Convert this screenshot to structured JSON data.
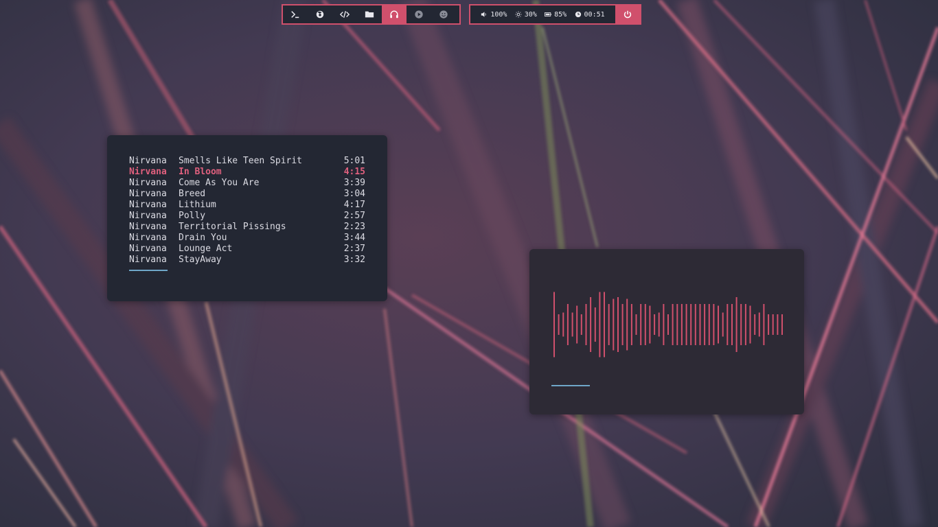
{
  "theme": {
    "accent": "#d0506c",
    "panel": "#232733",
    "highlight": "#e0607e",
    "progress": "#6fa7c9"
  },
  "top_bar": {
    "launchers": [
      {
        "name": "terminal-icon",
        "active": false
      },
      {
        "name": "firefox-icon",
        "active": false
      },
      {
        "name": "code-icon",
        "active": false
      },
      {
        "name": "folder-icon",
        "active": false
      },
      {
        "name": "headphones-icon",
        "active": true
      },
      {
        "name": "play-circle-icon",
        "active": false
      },
      {
        "name": "smiley-icon",
        "active": false
      }
    ],
    "status": {
      "volume": "100%",
      "brightness": "30%",
      "battery": "85%",
      "clock": "00:51"
    },
    "power_icon": "power-icon"
  },
  "playlist": {
    "current_index": 1,
    "tracks": [
      {
        "artist": "Nirvana",
        "title": "Smells Like Teen Spirit",
        "duration": "5:01"
      },
      {
        "artist": "Nirvana",
        "title": "In Bloom",
        "duration": "4:15"
      },
      {
        "artist": "Nirvana",
        "title": "Come As You Are",
        "duration": "3:39"
      },
      {
        "artist": "Nirvana",
        "title": "Breed",
        "duration": "3:04"
      },
      {
        "artist": "Nirvana",
        "title": "Lithium",
        "duration": "4:17"
      },
      {
        "artist": "Nirvana",
        "title": "Polly",
        "duration": "2:57"
      },
      {
        "artist": "Nirvana",
        "title": "Territorial Pissings",
        "duration": "2:23"
      },
      {
        "artist": "Nirvana",
        "title": "Drain You",
        "duration": "3:44"
      },
      {
        "artist": "Nirvana",
        "title": "Lounge Act",
        "duration": "2:37"
      },
      {
        "artist": "Nirvana",
        "title": "StayAway",
        "duration": "3:32"
      }
    ]
  },
  "visualizer": {
    "color": "#d0506c",
    "levels": [
      0.95,
      0.3,
      0.35,
      0.6,
      0.35,
      0.55,
      0.3,
      0.6,
      0.8,
      0.5,
      0.95,
      0.95,
      0.6,
      0.75,
      0.8,
      0.6,
      0.75,
      0.6,
      0.3,
      0.6,
      0.6,
      0.55,
      0.3,
      0.35,
      0.6,
      0.3,
      0.6,
      0.6,
      0.6,
      0.6,
      0.6,
      0.6,
      0.6,
      0.6,
      0.6,
      0.6,
      0.55,
      0.35,
      0.6,
      0.6,
      0.8,
      0.6,
      0.6,
      0.55,
      0.3,
      0.35,
      0.6,
      0.3,
      0.3,
      0.3,
      0.3
    ]
  }
}
